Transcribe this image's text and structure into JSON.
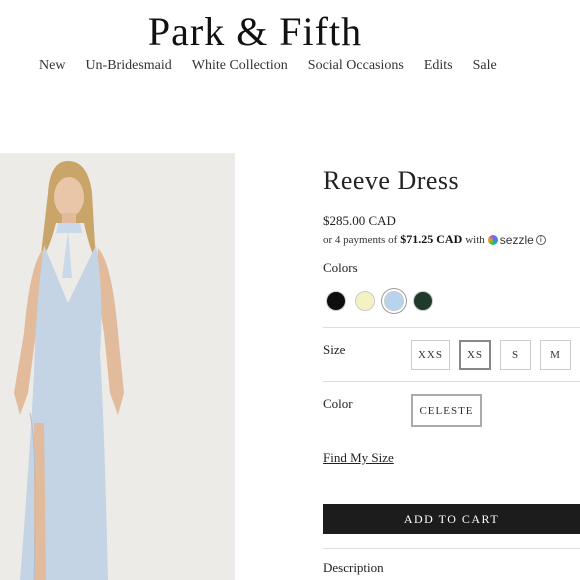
{
  "brand": "Park & Fifth",
  "nav": [
    "New",
    "Un-Bridesmaid",
    "White Collection",
    "Social Occasions",
    "Edits",
    "Sale"
  ],
  "product": {
    "title": "Reeve Dress",
    "price": "$285.00 CAD",
    "installments_prefix": "or 4 payments of",
    "installment_amount": "$71.25 CAD",
    "installments_with": "with",
    "sezzle": "sezzle",
    "info_glyph": "i"
  },
  "colors": {
    "label": "Colors",
    "swatches": [
      {
        "name": "black",
        "hex": "#0d0d0d"
      },
      {
        "name": "butter",
        "hex": "#f4f1c3"
      },
      {
        "name": "celeste",
        "hex": "#b7d3ee"
      },
      {
        "name": "emerald",
        "hex": "#1f3a2a"
      }
    ],
    "selected_index": 2
  },
  "size": {
    "label": "Size",
    "options": [
      "XXS",
      "XS",
      "S",
      "M",
      ""
    ],
    "selected": "XS"
  },
  "color": {
    "label": "Color",
    "value": "CELESTE"
  },
  "find_size": "Find My Size",
  "add_to_cart": "ADD TO CART",
  "description": "Description"
}
